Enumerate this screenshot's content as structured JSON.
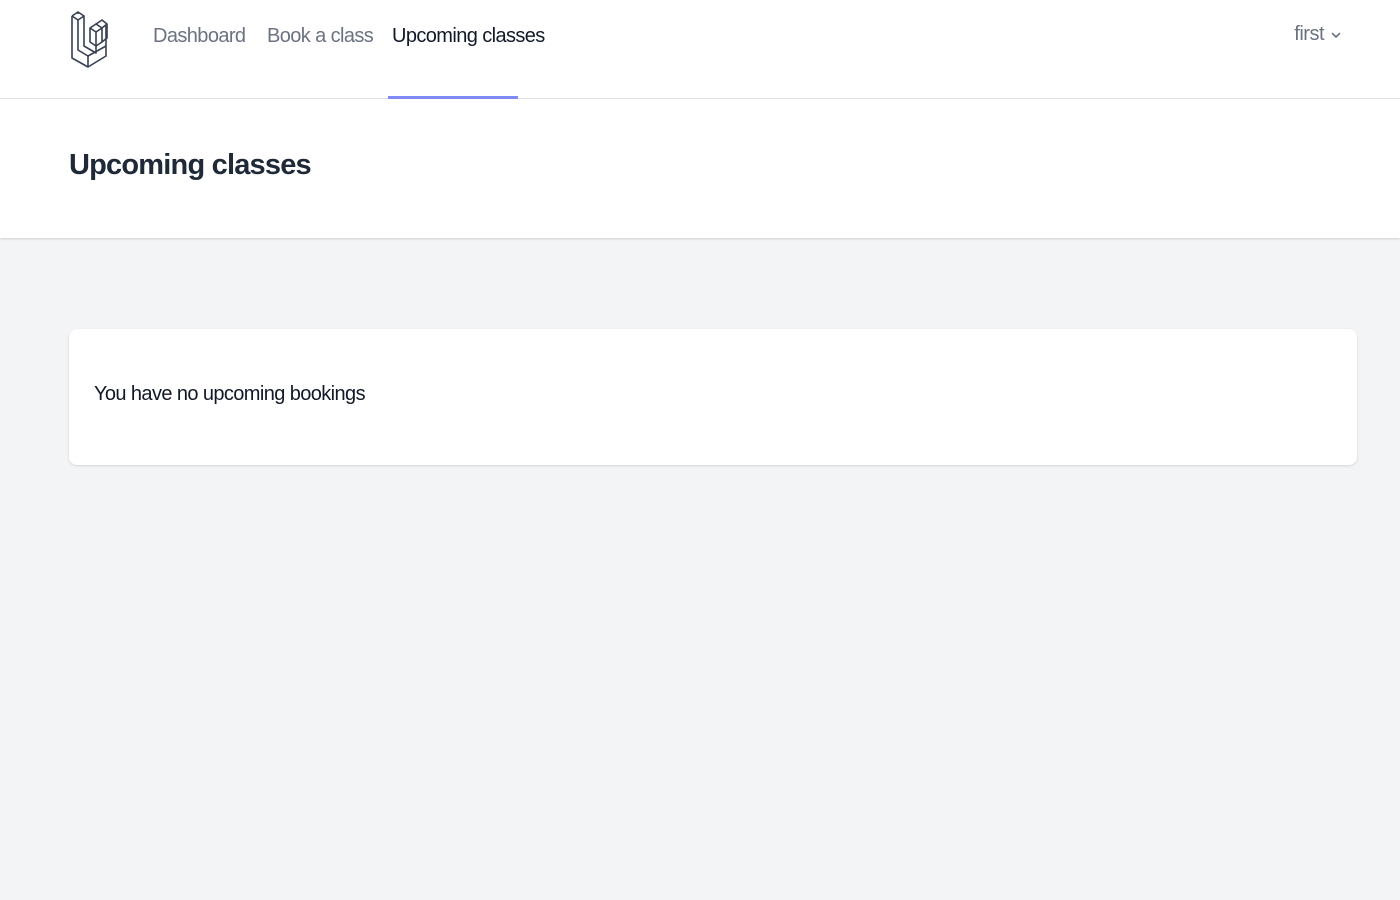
{
  "navbar": {
    "logo_icon": "laravel-logo-icon",
    "links": [
      {
        "label": "Dashboard",
        "active": false
      },
      {
        "label": "Book a class",
        "active": false
      },
      {
        "label": "Upcoming classes",
        "active": true
      }
    ],
    "user": {
      "name": "first",
      "icon": "chevron-down-icon"
    }
  },
  "header": {
    "title": "Upcoming classes"
  },
  "main": {
    "empty_message": "You have no upcoming bookings"
  },
  "colors": {
    "active_underline": "#818cf8",
    "page_background": "#f3f4f6",
    "surface": "#ffffff"
  }
}
